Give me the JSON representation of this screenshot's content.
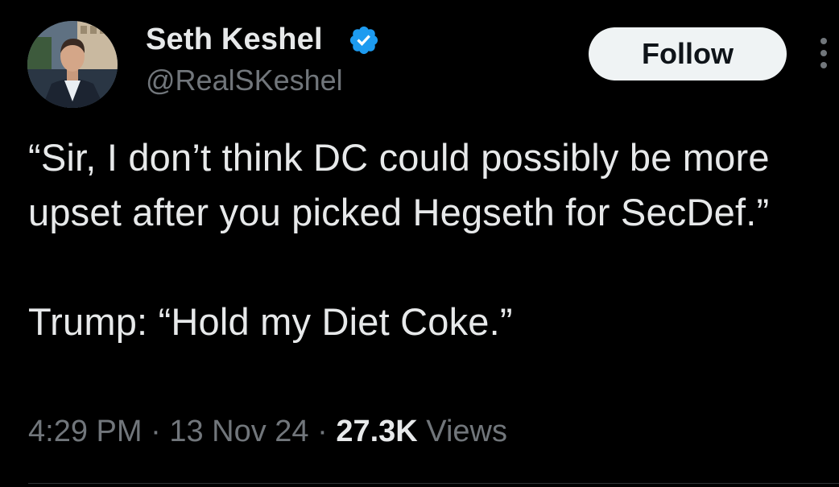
{
  "author": {
    "display_name": "Seth Keshel",
    "handle": "@RealSKeshel",
    "verified": true
  },
  "actions": {
    "follow_label": "Follow",
    "more_icon": "more-vertical-icon"
  },
  "tweet": {
    "text": "“Sir, I don’t think DC could possibly be more upset after you picked Hegseth for SecDef.”\n\nTrump: “Hold my Diet Coke.”"
  },
  "meta": {
    "time": "4:29 PM",
    "separator": "·",
    "date": "13 Nov 24",
    "views_count": "27.3K",
    "views_label": "Views"
  },
  "colors": {
    "background": "#000000",
    "text": "#e7e9ea",
    "secondary": "#71767b",
    "verified": "#1d9bf0",
    "follow_bg": "#eff3f4"
  }
}
